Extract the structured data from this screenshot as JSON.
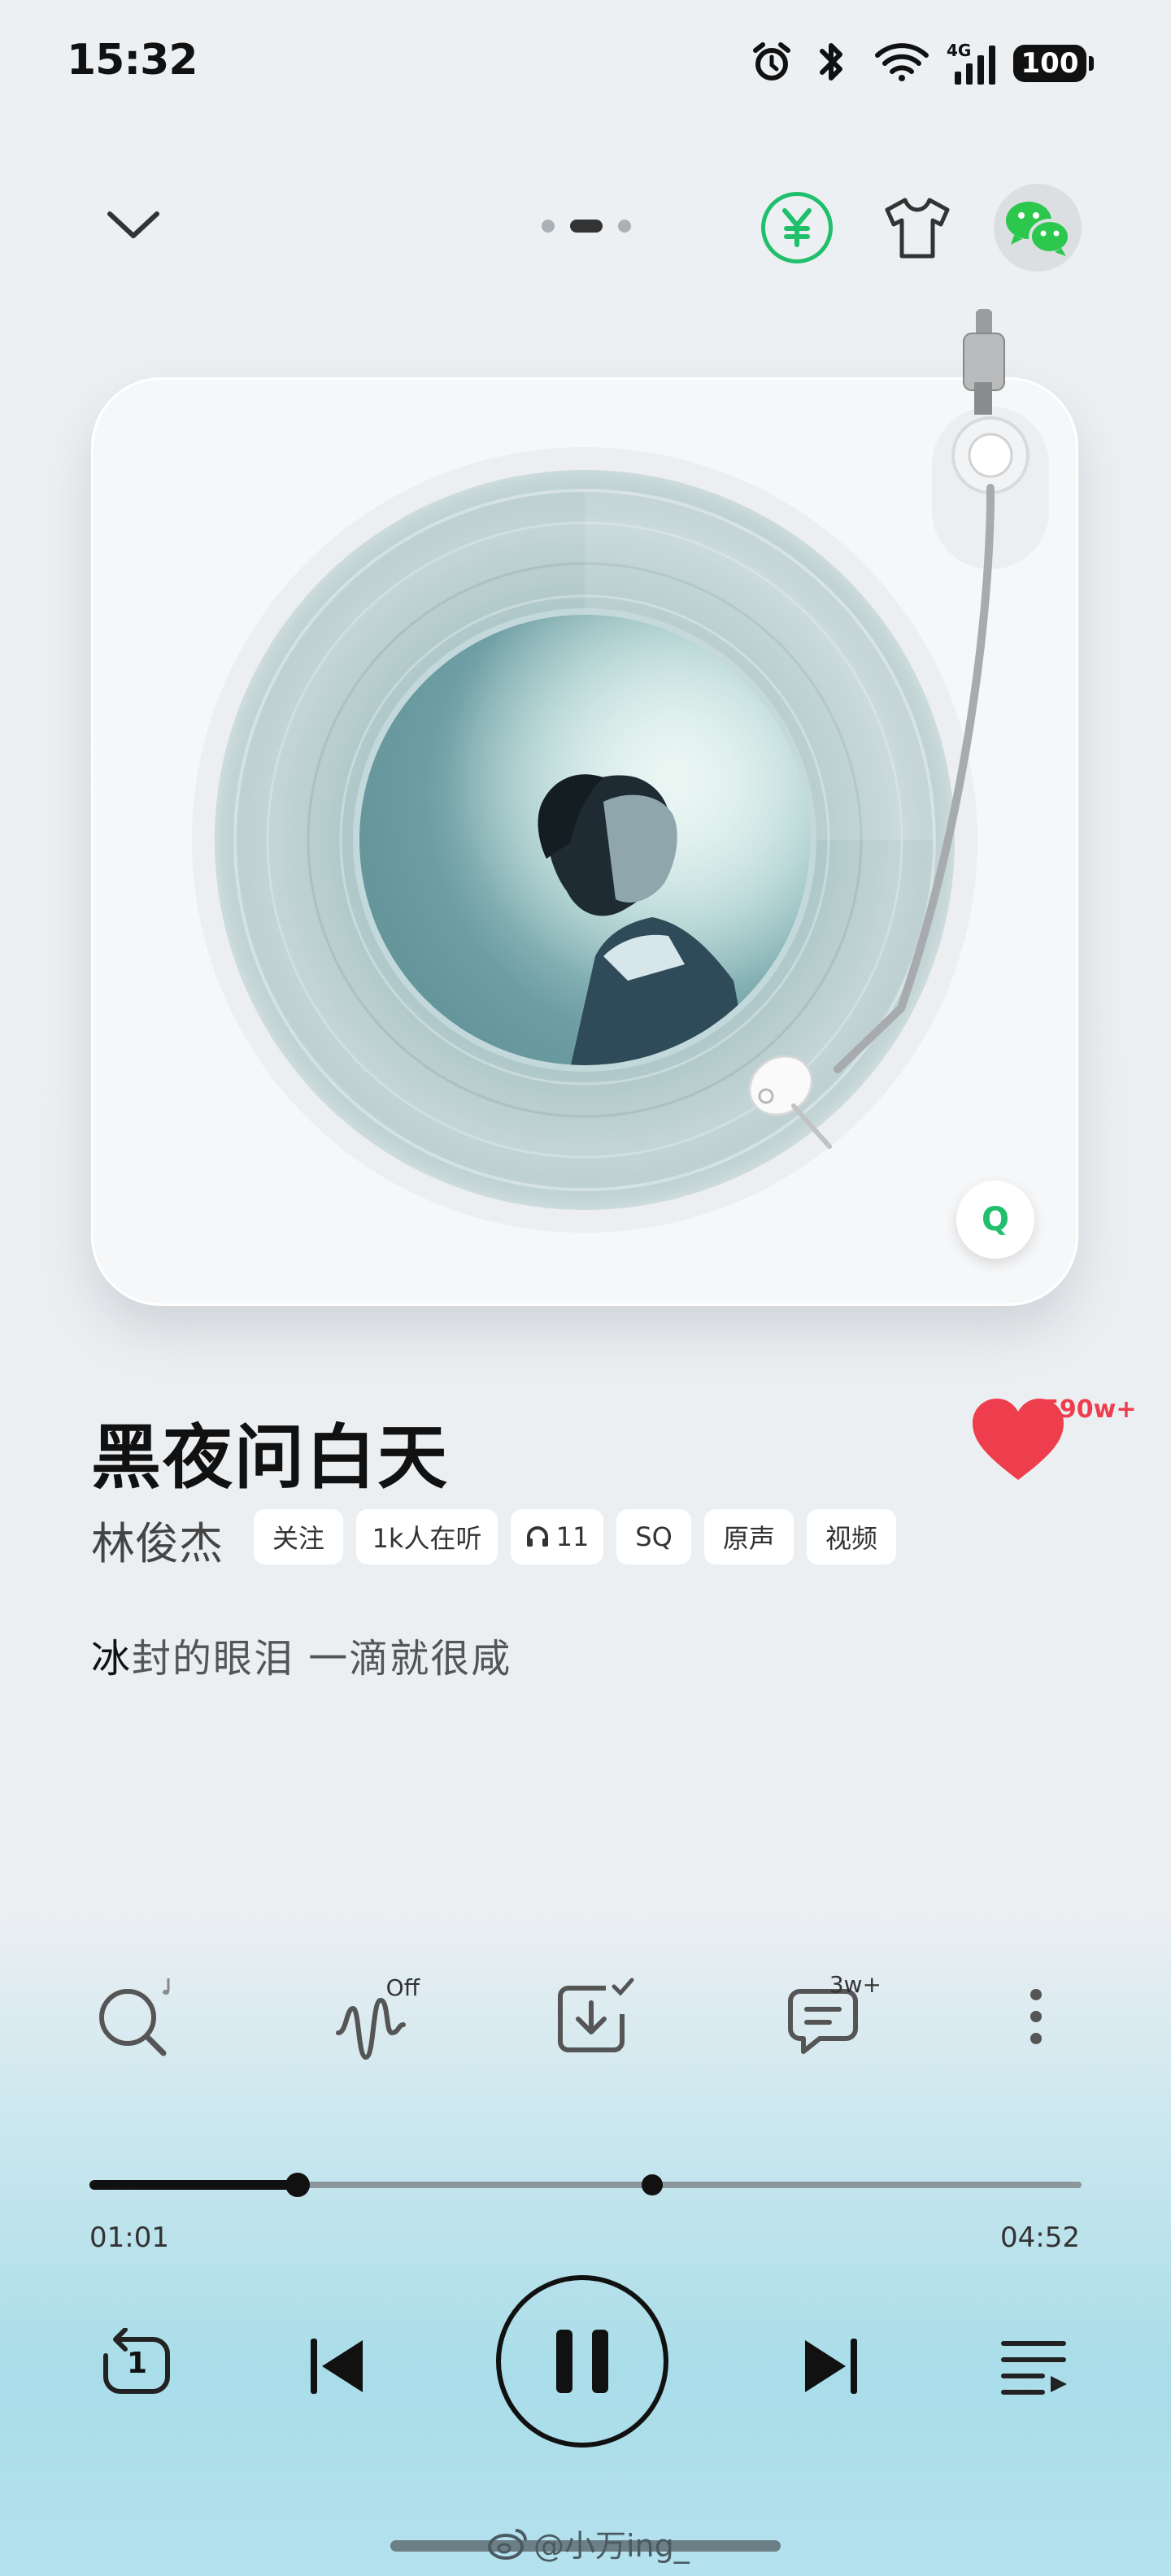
{
  "status_bar": {
    "time": "15:32",
    "network": "4G",
    "battery": "100",
    "icons": [
      "alarm-icon",
      "bluetooth-icon",
      "wifi-icon",
      "cellular-signal-icon",
      "battery-icon"
    ]
  },
  "top_nav": {
    "collapse_icon": "chevron-down-icon",
    "page_indicator": {
      "count": 3,
      "active_index": 1
    },
    "actions": [
      "yuan-coin-icon",
      "t-shirt-skin-icon",
      "wechat-icon"
    ]
  },
  "player_card": {
    "badge_letter": "Q"
  },
  "song": {
    "title": "黑夜问白天",
    "artist": "林俊杰",
    "tags": [
      "关注",
      "1k人在听",
      "11",
      "SQ",
      "原声",
      "视频"
    ],
    "like_count": "590w+",
    "lyric_first_char": "冰",
    "lyric_rest": "封的眼泪 一滴就很咸"
  },
  "actions": {
    "search_icon": "search-music-icon",
    "effect_badge": "Off",
    "download_icon": "download-icon",
    "comment_badge": "3w+",
    "more_icon": "more-vertical-icon"
  },
  "progress": {
    "elapsed": "01:01",
    "total": "04:52",
    "played_fraction": 0.21,
    "buffered_fraction": 0.567
  },
  "controls": {
    "repeat_mode_number": "1",
    "icons": [
      "repeat-one-icon",
      "previous-icon",
      "pause-icon",
      "next-icon",
      "playlist-icon"
    ]
  },
  "watermark": "@小万ing_",
  "colors": {
    "accent_green": "#1fbf6b",
    "like_red": "#ee3e4d",
    "wechat_green": "#2bc84d"
  }
}
